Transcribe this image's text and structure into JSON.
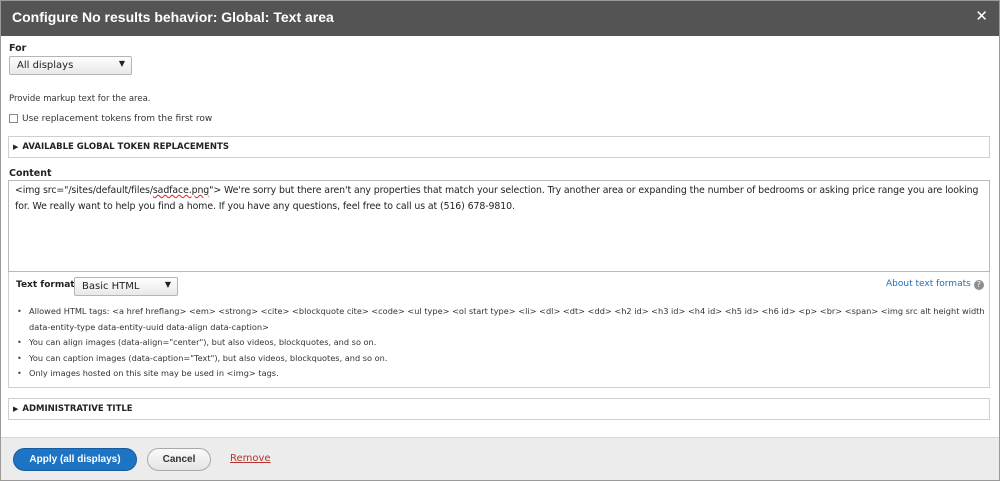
{
  "dialog": {
    "title": "Configure No results behavior: Global: Text area",
    "close_glyph": "✕"
  },
  "for_field": {
    "label": "For",
    "selected": "All displays"
  },
  "description": "Provide markup text for the area.",
  "replacement_tokens": {
    "label": "Use replacement tokens from the first row",
    "checked": false
  },
  "token_section": {
    "label": "AVAILABLE GLOBAL TOKEN REPLACEMENTS"
  },
  "content": {
    "label": "Content",
    "value_start": "<img src=\"/sites/default/files/",
    "value_misspelled": "sadface.png",
    "value_rest": "\"> We're sorry but there aren't any properties that match your selection.  Try another area or expanding the number of bedrooms or asking price range you are looking for.  We really want to help you find a home.  If you have any questions, feel free to call us at (516) 678-9810."
  },
  "text_format": {
    "label": "Text format",
    "selected": "Basic HTML",
    "about_link": "About text formats",
    "guidelines": [
      "Allowed HTML tags: <a href hreflang> <em> <strong> <cite> <blockquote cite> <code> <ul type> <ol start type> <li> <dl> <dt> <dd> <h2 id> <h3 id> <h4 id> <h5 id> <h6 id> <p> <br> <span> <img src alt height width data-entity-type data-entity-uuid data-align data-caption>",
      "You can align images (data-align=\"center\"), but also videos, blockquotes, and so on.",
      "You can caption images (data-caption=\"Text\"), but also videos, blockquotes, and so on.",
      "Only images hosted on this site may be used in <img> tags."
    ]
  },
  "admin_title_section": {
    "label": "ADMINISTRATIVE TITLE"
  },
  "footer": {
    "apply_label": "Apply (all displays)",
    "cancel_label": "Cancel",
    "remove_label": "Remove"
  },
  "colors": {
    "title_bar": "#545454",
    "primary_button": "#1d73c4",
    "link": "#1f6fb4",
    "remove_link": "#b5352d"
  }
}
